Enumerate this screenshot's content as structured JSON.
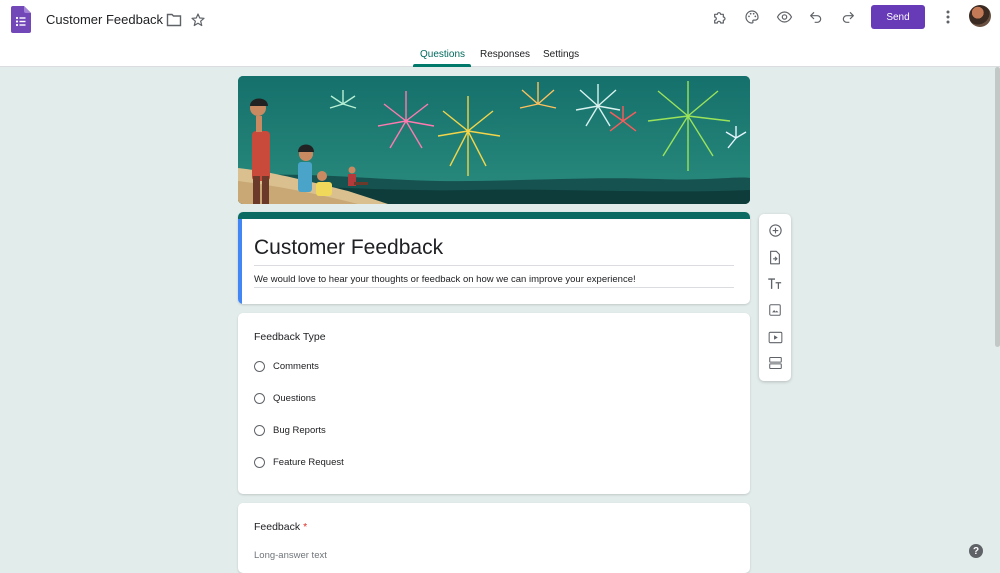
{
  "app": {
    "doc_title": "Customer Feedback",
    "send_label": "Send",
    "accent_color": "#673ab7",
    "theme_color": "#00796b"
  },
  "tabs": [
    {
      "label": "Questions",
      "active": true
    },
    {
      "label": "Responses",
      "active": false
    },
    {
      "label": "Settings",
      "active": false
    }
  ],
  "header_icons": [
    "forms-logo-icon",
    "folder-icon",
    "star-icon",
    "addon-puzzle-icon",
    "palette-icon",
    "preview-eye-icon",
    "undo-icon",
    "redo-icon",
    "more-vert-icon"
  ],
  "form": {
    "title": "Customer Feedback",
    "description": "We would love to hear your thoughts or feedback on how we can improve your experience!"
  },
  "questions": [
    {
      "title": "Feedback Type",
      "type": "multiple-choice",
      "options": [
        "Comments",
        "Questions",
        "Bug Reports",
        "Feature Request"
      ]
    },
    {
      "title": "Feedback",
      "required_marker": "*",
      "type": "paragraph",
      "placeholder": "Long-answer text"
    }
  ],
  "toolbar_icons": [
    "add-question-icon",
    "import-questions-icon",
    "add-title-icon",
    "add-image-icon",
    "add-video-icon",
    "add-section-icon"
  ],
  "help": {
    "label": "?"
  }
}
